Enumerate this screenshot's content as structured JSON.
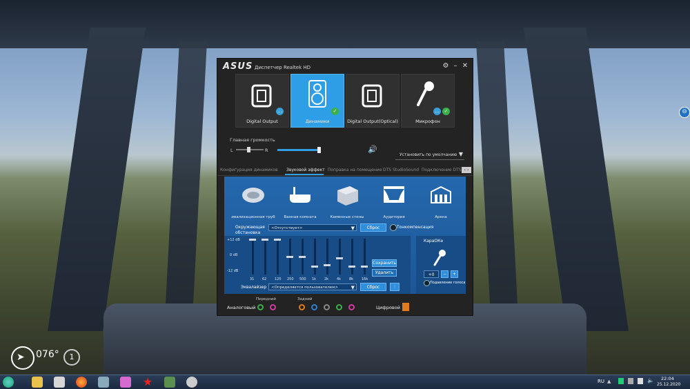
{
  "window": {
    "brand": "ASUS",
    "title": "Диспетчер Realtek HD"
  },
  "devices": [
    {
      "label": "Digital Output",
      "badge": "chat"
    },
    {
      "label": "Динамики",
      "badge": "ok",
      "active": true
    },
    {
      "label": "Digital Output(Optical)",
      "badge": ""
    },
    {
      "label": "Микрофон",
      "badge": "both"
    }
  ],
  "volume": {
    "label": "Главная громкость",
    "left": "L",
    "right": "R",
    "default_device": "Установить по умолчанию"
  },
  "tabs": [
    "Конфигурация динамиков",
    "Звуковой эффект",
    "Поправка на помещение",
    "DTS StudioSound",
    "Подключение DTS"
  ],
  "effects": {
    "environments": [
      "ивализационная труб",
      "Ванная комната",
      "Каменные стены",
      "Аудитория",
      "Арена"
    ],
    "env_label": "Окружающая обстановка",
    "env_value": "<Отсутствует>",
    "reset": "Сброс",
    "loudness": "Тонкомпенсация",
    "db_labels": [
      "+12 dB",
      "0 dB",
      "-12 dB"
    ],
    "bands": [
      "31",
      "62",
      "125",
      "250",
      "500",
      "1k",
      "2k",
      "4k",
      "8k",
      "16k"
    ],
    "band_levels": [
      1.0,
      1.0,
      1.0,
      0.5,
      0.5,
      0.2,
      0.25,
      0.45,
      0.2,
      0.2
    ],
    "save": "Сохранить",
    "delete": "Удалить",
    "eq_label": "Эквалайзер",
    "eq_value": "<Определяется пользователем>",
    "karaoke": "КараОКе",
    "karaoke_value": "+0",
    "minus": "−",
    "plus": "+",
    "voice_cancel": "Подавление голоса"
  },
  "jacks": {
    "analog": "Аналоговый",
    "front": "Передний",
    "rear": "Задний",
    "digital": "Цифровой"
  },
  "hud": {
    "heading": "076°",
    "counter": "1"
  },
  "taskbar": {
    "lang": "RU",
    "time": "22:04",
    "date": "25.12.2020"
  },
  "colors": {
    "accent": "#2e9ee6",
    "panel": "#1e5fa3",
    "ok": "#3cb04b"
  }
}
